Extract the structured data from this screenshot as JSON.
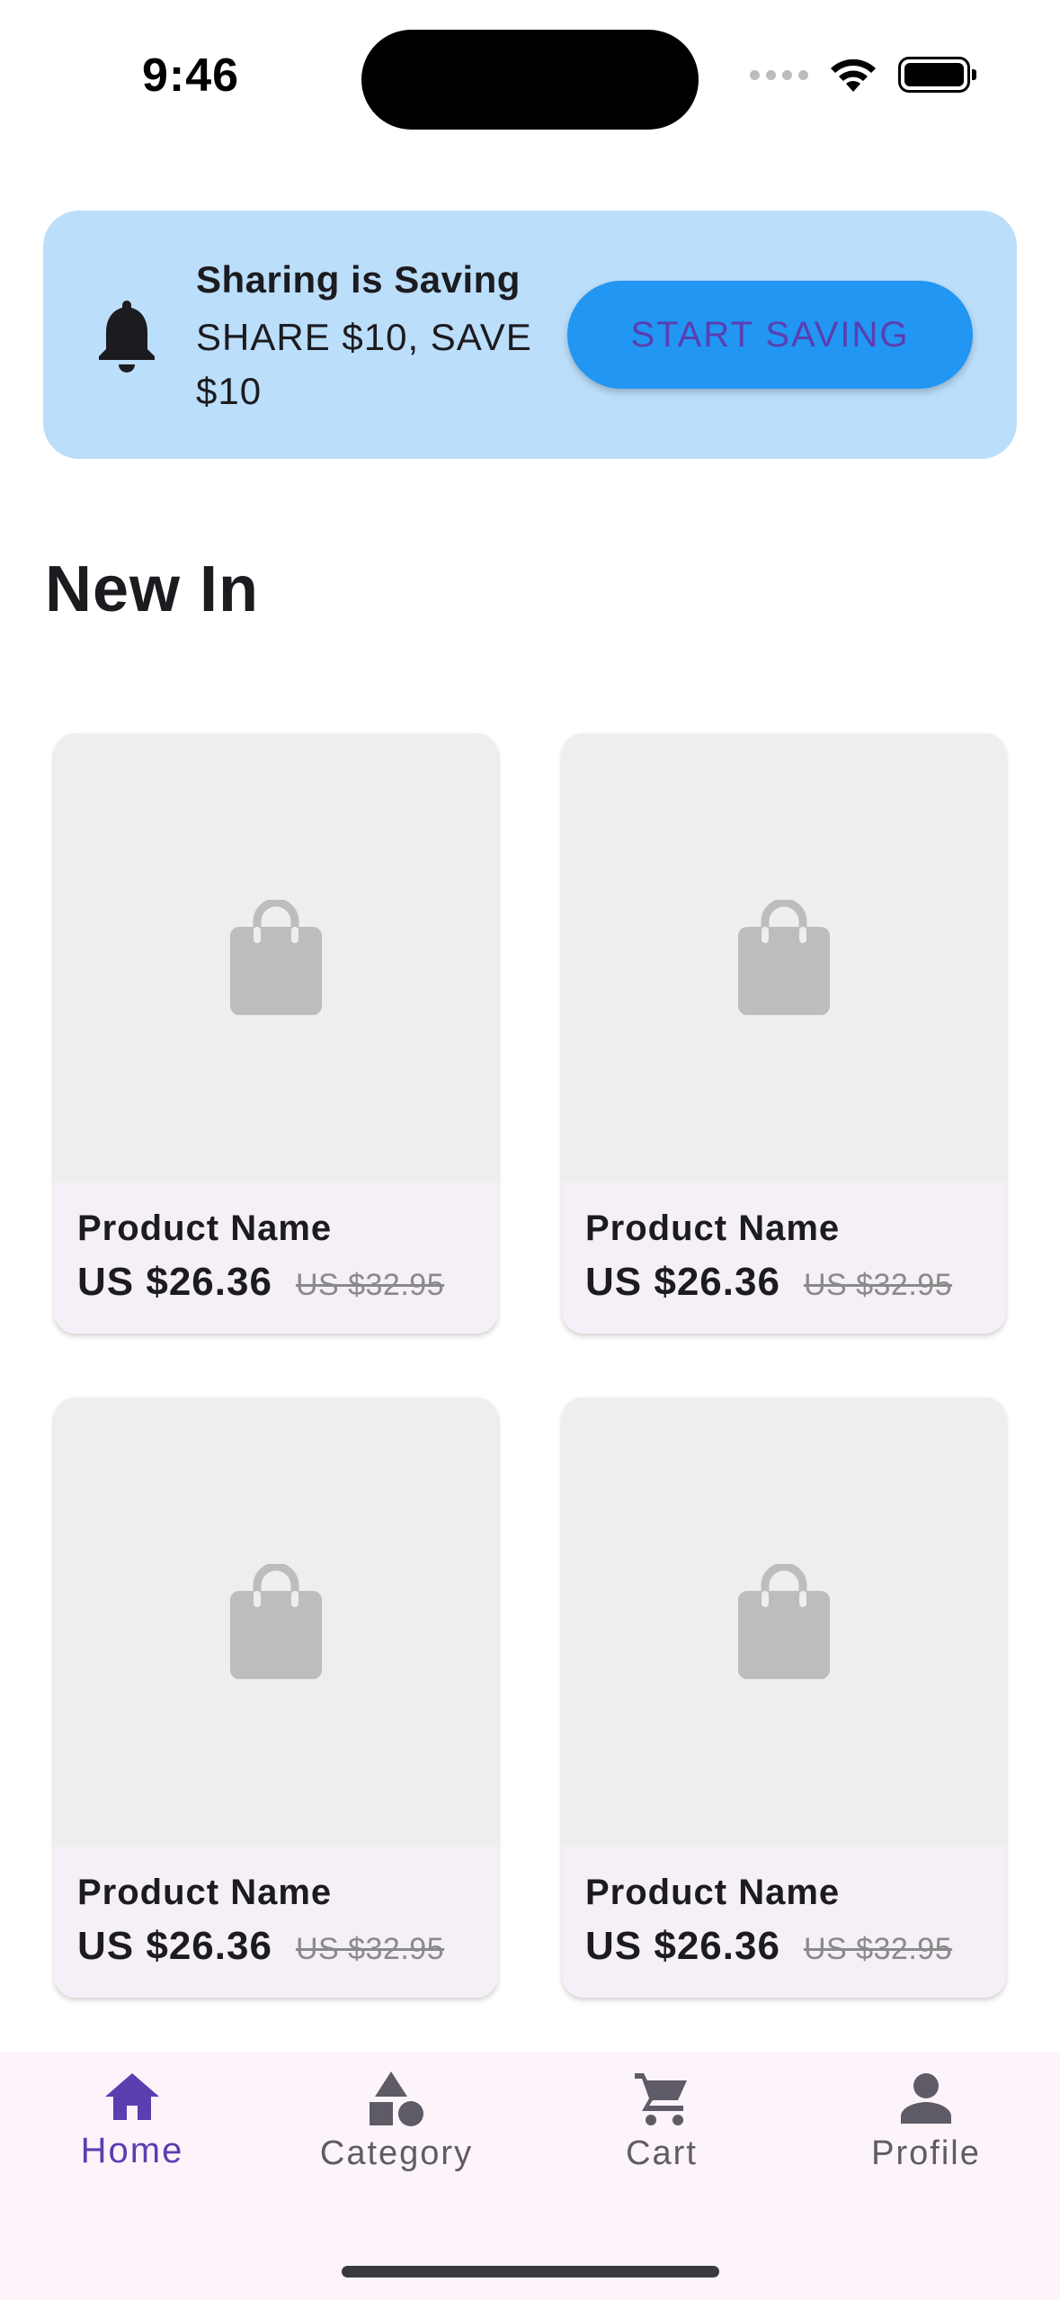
{
  "status_bar": {
    "time": "9:46",
    "icons": [
      "signal-dots-icon",
      "wifi-icon",
      "battery-icon"
    ]
  },
  "banner": {
    "icon": "bell-icon",
    "title": "Sharing is Saving",
    "subtitle": "SHARE $10, SAVE $10",
    "button_label": "START SAVING",
    "background_color": "#bbdefb",
    "button_color": "#2196f3"
  },
  "section": {
    "title": "New In"
  },
  "products": [
    {
      "name": "Product Name",
      "price": "US $26.36",
      "old_price": "US $32.95",
      "icon": "shopping-bag-icon"
    },
    {
      "name": "Product Name",
      "price": "US $26.36",
      "old_price": "US $32.95",
      "icon": "shopping-bag-icon"
    },
    {
      "name": "Product Name",
      "price": "US $26.36",
      "old_price": "US $32.95",
      "icon": "shopping-bag-icon"
    },
    {
      "name": "Product Name",
      "price": "US $26.36",
      "old_price": "US $32.95",
      "icon": "shopping-bag-icon"
    }
  ],
  "bottom_nav": {
    "items": [
      {
        "label": "Home",
        "icon": "home-icon",
        "active": true
      },
      {
        "label": "Category",
        "icon": "category-icon",
        "active": false
      },
      {
        "label": "Cart",
        "icon": "cart-icon",
        "active": false
      },
      {
        "label": "Profile",
        "icon": "profile-icon",
        "active": false
      }
    ],
    "active_color": "#5a3fb0",
    "inactive_color": "#5f5b66"
  }
}
